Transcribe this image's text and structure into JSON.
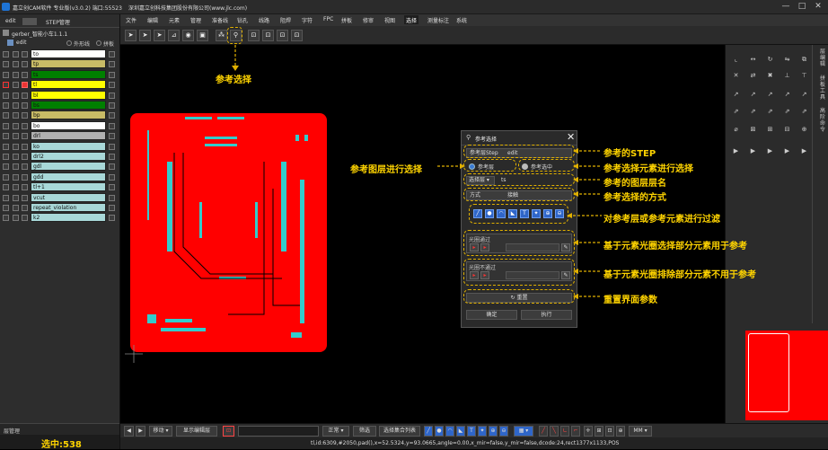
{
  "window": {
    "title": "嘉立创CAM软件 专业版(v3.0.2) 端口:55523",
    "company": "深圳嘉立创科技集团股份有限公司(www.jlc.com)",
    "controls": [
      "—",
      "□",
      "✕"
    ]
  },
  "menubar": {
    "items": [
      "文件",
      "编辑",
      "元素",
      "管理",
      "准备线",
      "钻孔",
      "线路",
      "阻焊",
      "字符",
      "FPC",
      "拼板",
      "修审",
      "视图",
      "选择",
      "测量标注",
      "系统"
    ],
    "active": "选择"
  },
  "left_panel": {
    "tabs": [
      "edit",
      "STEP管理"
    ],
    "tree_root": "gerber_智能小车1.1.1",
    "tree_child": "edit",
    "options": [
      "外形线",
      "拼板"
    ],
    "layers": [
      {
        "name": "to",
        "color": "#ffffff"
      },
      {
        "name": "tp",
        "color": "#c8bb66"
      },
      {
        "name": "ts",
        "color": "#008000"
      },
      {
        "name": "tl",
        "color": "#ffff00"
      },
      {
        "name": "bl",
        "color": "#ffff00"
      },
      {
        "name": "bs",
        "color": "#008000"
      },
      {
        "name": "bp",
        "color": "#c8bb66"
      },
      {
        "name": "bo",
        "color": "#ffffff"
      },
      {
        "name": "drl",
        "color": "#b0b0b0"
      },
      {
        "name": "ko",
        "color": "#a8d8d8"
      },
      {
        "name": "drl2",
        "color": "#a8d8d8"
      },
      {
        "name": "gdl",
        "color": "#a8d8d8"
      },
      {
        "name": "gdd",
        "color": "#a8d8d8"
      },
      {
        "name": "tl+1",
        "color": "#a8d8d8"
      },
      {
        "name": "vcut",
        "color": "#a8d8d8"
      },
      {
        "name": "repeat_violation",
        "color": "#a8d8d8"
      },
      {
        "name": "k2",
        "color": "#a8d8d8"
      }
    ],
    "footer_tab": "层管理",
    "selected_count": "选中:538"
  },
  "dialog": {
    "title": "参考选择",
    "step_label": "参考层Step",
    "step_value": "edit",
    "radio_layer": "参考层",
    "radio_element": "参考选中",
    "layer_select_label": "选择层",
    "layer_value": "ts",
    "mode_label": "方式",
    "mode_value": "接触",
    "include_label": "光圈通过",
    "exclude_label": "光圈不通过",
    "reset_label": "重置",
    "ok_label": "确定",
    "run_label": "执行"
  },
  "annotations": {
    "ref_select": "参考选择",
    "ref_step": "参考的STEP",
    "layer_select": "参考图层进行选择",
    "element_select": "参考选择元素进行选择",
    "layer_name": "参考的图层层名",
    "method": "参考选择的方式",
    "filter": "对参考层或参考元素进行过滤",
    "include": "基于元素光圈选择部分元素用于参考",
    "exclude": "基于元素光圈排除部分元素不用于参考",
    "reset": "重置界面参数"
  },
  "bottom_bar": {
    "mode": "移动",
    "display": "显示编辑层",
    "fill": "正常",
    "filter_btn": "筛选",
    "select_btn": "选择集合列表",
    "unit": "MM"
  },
  "right_panel": {
    "labels": [
      "层编辑",
      "拼板工具",
      "高阶命令"
    ]
  },
  "statusbar": {
    "text": "tl,id:6309,#2050,pad(),x=52.5324,y=93.0665,angle=0.00,x_mir=false,y_mir=false,dcode:24,rect1377x1133,POS"
  },
  "colors": {
    "board": "#ff0000",
    "pads": "#33cccc",
    "annotation": "#ffd400",
    "preview": "#ff0000"
  }
}
